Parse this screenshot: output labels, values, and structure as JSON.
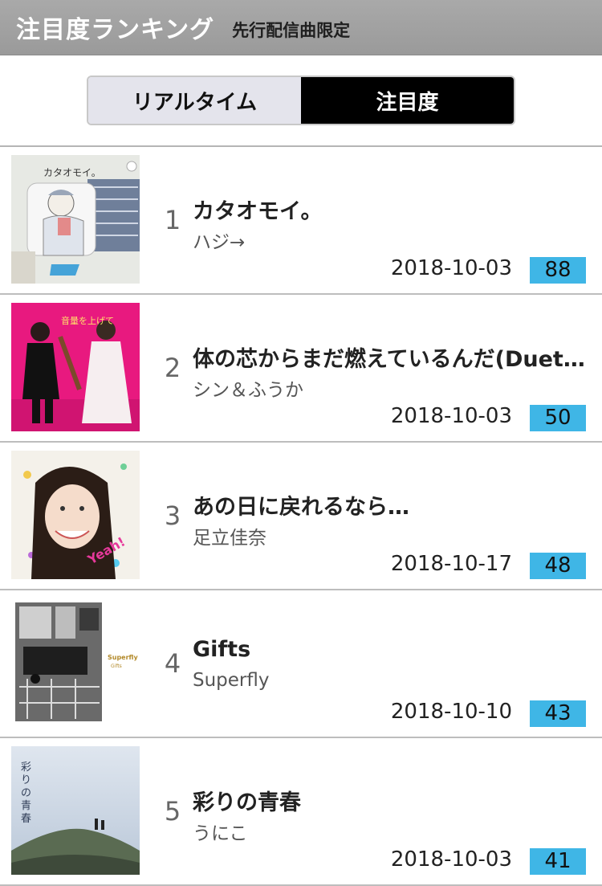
{
  "header": {
    "title": "注目度ランキング",
    "subtitle": "先行配信曲限定"
  },
  "tabs": [
    {
      "label": "リアルタイム",
      "active": false
    },
    {
      "label": "注目度",
      "active": true
    }
  ],
  "colors": {
    "header_bg": "#a0a0a0",
    "score_badge": "#3fb6e6",
    "active_tab": "#000000"
  },
  "items": [
    {
      "rank": "1",
      "title": "カタオモイ。",
      "artist": "ハジ→",
      "date": "2018-10-03",
      "score": "88"
    },
    {
      "rank": "2",
      "title": "体の芯からまだ燃えているんだ(Duet with ふうか)",
      "artist": "シン＆ふうか",
      "date": "2018-10-03",
      "score": "50"
    },
    {
      "rank": "3",
      "title": "あの日に戻れるなら…",
      "artist": "足立佳奈",
      "date": "2018-10-17",
      "score": "48"
    },
    {
      "rank": "4",
      "title": "Gifts",
      "artist": "Superfly",
      "date": "2018-10-10",
      "score": "43"
    },
    {
      "rank": "5",
      "title": "彩りの青春",
      "artist": "うにこ",
      "date": "2018-10-03",
      "score": "41"
    }
  ]
}
